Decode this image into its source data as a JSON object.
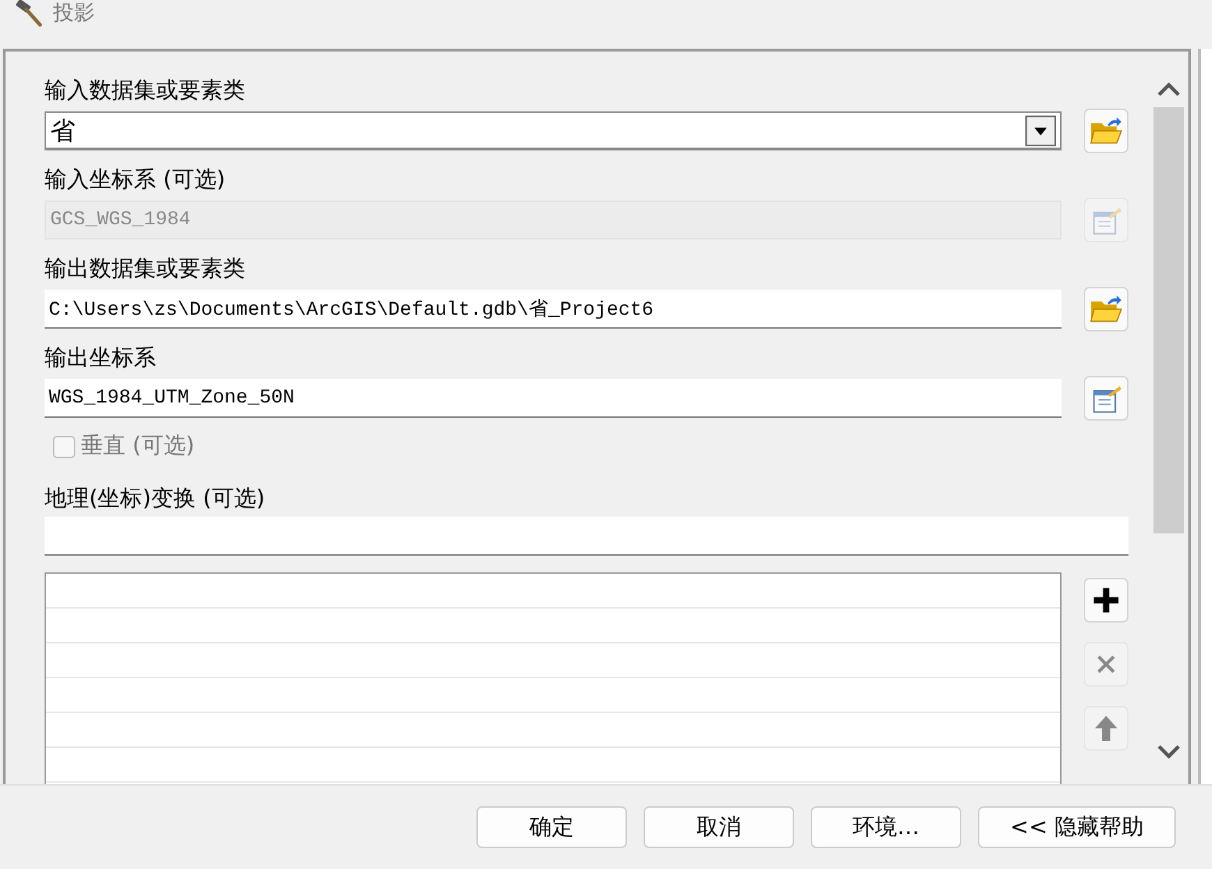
{
  "window": {
    "title": "投影"
  },
  "params": [
    {
      "kind": "combo",
      "label": "输入数据集或要素类",
      "value": "省",
      "disabled": false,
      "browse": true
    },
    {
      "kind": "text",
      "label": "输入坐标系 (可选)",
      "value": "GCS_WGS_1984",
      "disabled": true,
      "browse": false
    },
    {
      "kind": "text",
      "label": "输出数据集或要素类",
      "value": "C:\\Users\\zs\\Documents\\ArcGIS\\Default.gdb\\省_Project6",
      "disabled": false,
      "browse": true
    },
    {
      "kind": "text",
      "label": "输出坐标系",
      "value": "WGS_1984_UTM_Zone_50N",
      "disabled": false,
      "browse": false
    }
  ],
  "checkbox": {
    "label": "垂直 (可选)",
    "checked": false,
    "disabled": true
  },
  "transform": {
    "label": "地理(坐标)变换 (可选)"
  },
  "list_buttons": [
    {
      "kind": "add",
      "disabled": false
    },
    {
      "kind": "remove",
      "disabled": true
    },
    {
      "kind": "up",
      "disabled": true
    }
  ],
  "buttons": [
    "确定",
    "取消",
    "环境…",
    "<< 隐藏帮助"
  ]
}
